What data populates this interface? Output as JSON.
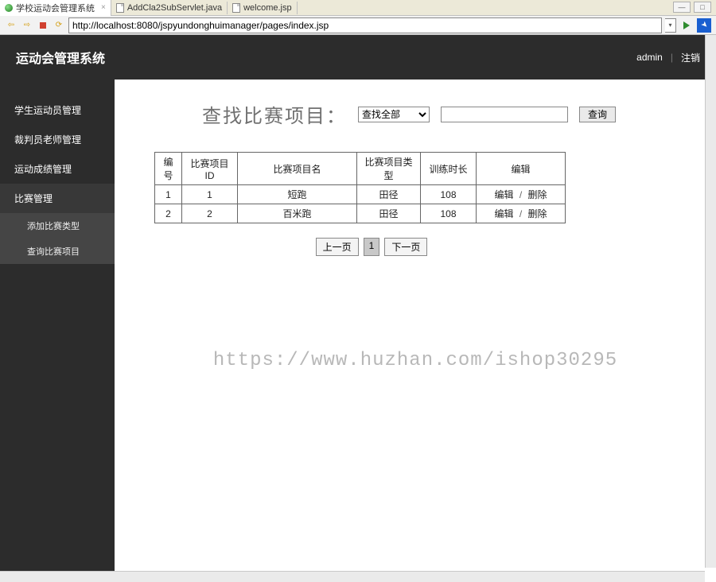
{
  "ide": {
    "tabs": [
      {
        "label": "学校运动会管理系统",
        "icon": "globe"
      },
      {
        "label": "AddCla2SubServlet.java",
        "icon": "file"
      },
      {
        "label": "welcome.jsp",
        "icon": "file"
      }
    ]
  },
  "browser": {
    "url": "http://localhost:8080/jspyundonghuimanager/pages/index.jsp"
  },
  "header": {
    "title": "运动会管理系统",
    "user": "admin",
    "logout": "注销"
  },
  "sidebar": {
    "items": [
      {
        "label": "学生运动员管理"
      },
      {
        "label": "裁判员老师管理"
      },
      {
        "label": "运动成绩管理"
      },
      {
        "label": "比赛管理",
        "active": true,
        "children": [
          {
            "label": "添加比赛类型"
          },
          {
            "label": "查询比赛项目"
          }
        ]
      }
    ]
  },
  "search": {
    "title": "查找比赛项目：",
    "select_value": "查找全部",
    "input_value": "",
    "button": "查询"
  },
  "table": {
    "headers": [
      "编号",
      "比赛项目ID",
      "比赛项目名",
      "比赛项目类型",
      "训练时长",
      "编辑"
    ],
    "rows": [
      {
        "idx": "1",
        "id": "1",
        "name": "短跑",
        "type": "田径",
        "dur": "108"
      },
      {
        "idx": "2",
        "id": "2",
        "name": "百米跑",
        "type": "田径",
        "dur": "108"
      }
    ],
    "op_edit": "编辑",
    "op_delete": "删除"
  },
  "pager": {
    "prev": "上一页",
    "current": "1",
    "next": "下一页"
  },
  "watermark": "https://www.huzhan.com/ishop30295"
}
